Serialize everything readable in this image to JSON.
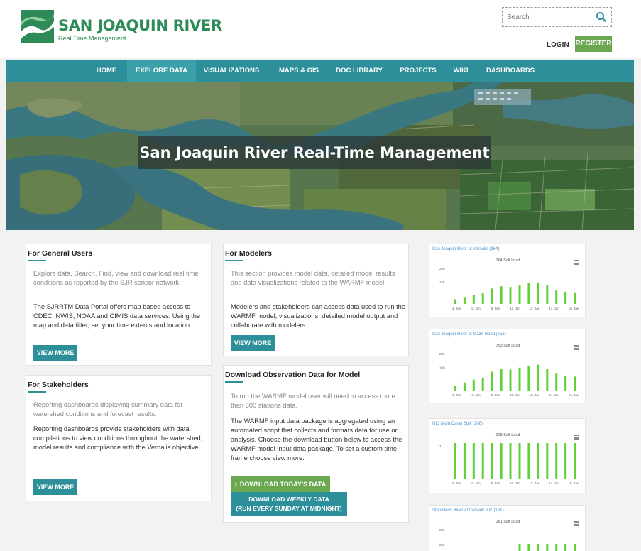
{
  "header": {
    "logo_title": "SAN JOAQUIN RIVER",
    "logo_subtitle": "Real Time Management",
    "search_placeholder": "Search",
    "login": "LOGIN",
    "register": "REGISTER"
  },
  "nav": {
    "items": [
      {
        "label": "HOME"
      },
      {
        "label": "EXPLORE DATA",
        "active": true
      },
      {
        "label": "VISUALIZATIONS"
      },
      {
        "label": "MAPS & GIS"
      },
      {
        "label": "DOC LIBRARY"
      },
      {
        "label": "PROJECTS"
      },
      {
        "label": "WIKI"
      },
      {
        "label": "DASHBOARDS"
      }
    ]
  },
  "hero": {
    "title": "San Joaquin River Real-Time Management"
  },
  "general_users": {
    "title": "For General Users",
    "intro": "Explore data. Search, Find, view and download real time conditions as reported by the SJR sensor network.",
    "body": "The SJRRTM Data Portal offers map based access to CDEC, NWIS, NOAA and CIMIS data services. Using the map and data filter, set your time extents and location.",
    "button": "VIEW MORE"
  },
  "stakeholders": {
    "title": "For Stakeholders",
    "intro": "Reporting dashboards displaying summary data for watershed conditions and forecast results.",
    "body": "Reporting dashboards provide stakeholders with data compilations to view conditions throughout the watershed, model results and compliance with the Vernalis objective.",
    "button": "VIEW MORE"
  },
  "modelers": {
    "title": "For Modelers",
    "intro": "This section provides model data, detailed model results and data visualizations related to the WARMF model.",
    "body": "Modelers and stakeholders can access data used to run the WARMF model, visualizations, detailed model output and collaborate with modelers.",
    "button": "VIEW MORE"
  },
  "download": {
    "title": "Download Observation Data for Model",
    "intro": "To run the WARMF model user will need to access more than 300 stations data.",
    "body": "The WARMF input data package is aggregated using an automated script that collects and formats data for use or analysis. Choose the download button below to access the WARMF model input data package. To set a custom time frame choose view more.",
    "button_today": "DOWNLOAD TODAY'S DATA",
    "button_weekly_line1": "DOWNLOAD WEEKLY DATA",
    "button_weekly_line2": "(RUN EVERY SUNDAY AT MIDNIGHT)"
  },
  "colors": {
    "teal": "#2d8f9a",
    "green": "#6aa84f",
    "logo_green": "#2e8b57",
    "bar_green": "#5fd035"
  },
  "chart_data": [
    {
      "type": "bar",
      "title": "San Joaquin River at Vernalis (164)",
      "subtitle": "164 Salt Load",
      "ytick_labels": [
        "250",
        "125"
      ],
      "xtick_labels": [
        "4. Jan",
        "6. Jan",
        "8. Jan",
        "10. Jan",
        "12. Jan",
        "14. Jan",
        "16. Jan"
      ],
      "values": [
        30,
        45,
        60,
        70,
        100,
        115,
        110,
        120,
        135,
        140,
        120,
        90,
        80,
        75
      ]
    },
    {
      "type": "bar",
      "title": "San Joaquin River at Maze Road (753)",
      "subtitle": "753 Salt Load",
      "ytick_labels": [
        "200",
        "100"
      ],
      "xtick_labels": [
        "4. Jan",
        "6. Jan",
        "8. Jan",
        "10. Jan",
        "12. Jan",
        "14. Jan",
        "16. Jan"
      ],
      "values": [
        25,
        40,
        55,
        65,
        95,
        110,
        105,
        115,
        125,
        130,
        110,
        85,
        75,
        70
      ]
    },
    {
      "type": "bar",
      "title": "NID Main Canal Spill (208)",
      "subtitle": "208 Salt Load",
      "ytick_labels": [
        "2"
      ],
      "xtick_labels": [
        "4. Jan",
        "6. Jan",
        "8. Jan",
        "10. Jan",
        "12. Jan",
        "14. Jan",
        "16. Jan"
      ],
      "values": [
        2,
        2,
        2,
        2,
        2,
        2,
        2,
        2,
        2,
        2,
        2,
        2,
        2,
        2
      ]
    },
    {
      "type": "bar",
      "title": "Stanislaus River at Caswell S.P. (161)",
      "subtitle": "161 Salt Load",
      "ytick_labels": [
        "500",
        "250"
      ],
      "xtick_labels": [],
      "values": [
        0,
        0,
        0,
        0,
        0,
        0,
        0,
        300,
        300,
        300,
        300,
        300,
        300,
        300
      ]
    }
  ]
}
